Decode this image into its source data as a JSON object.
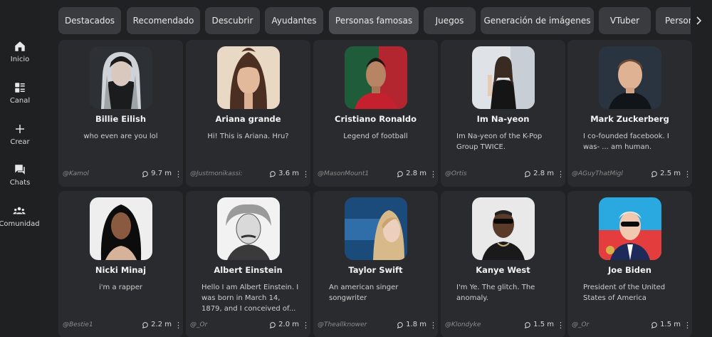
{
  "sidebar": {
    "items": [
      {
        "label": "Inicio",
        "icon": "home-icon"
      },
      {
        "label": "Canal",
        "icon": "feed-icon"
      },
      {
        "label": "Crear",
        "icon": "plus-icon"
      },
      {
        "label": "Chats",
        "icon": "chat-icon"
      },
      {
        "label": "Comunidad",
        "icon": "community-icon"
      }
    ]
  },
  "tabs": [
    {
      "label": "Destacados"
    },
    {
      "label": "Recomendado"
    },
    {
      "label": "Descubrir"
    },
    {
      "label": "Ayudantes"
    },
    {
      "label": "Personas famosas"
    },
    {
      "label": "Juegos"
    },
    {
      "label": "Generación de imágenes"
    },
    {
      "label": "VTuber"
    },
    {
      "label": "Person"
    }
  ],
  "tabs_more_icon": "chevron-right-icon",
  "characters": [
    {
      "name": "Billie Eilish",
      "description": "who even are you lol",
      "creator": "@Kamol",
      "chats": "9.7 m"
    },
    {
      "name": "Ariana grande",
      "description": "Hi! This is Ariana. Hru?",
      "creator": "@Justmonikassi:",
      "chats": "3.6 m"
    },
    {
      "name": "Cristiano Ronaldo",
      "description": "Legend of football",
      "creator": "@MasonMount1",
      "chats": "2.8 m"
    },
    {
      "name": "Im Na-yeon",
      "description": "Im Na-yeon of the K-Pop Group TWICE.",
      "creator": "@Ortis",
      "chats": "2.8 m"
    },
    {
      "name": "Mark Zuckerberg",
      "description": "I co-founded facebook. I was- ... am human.",
      "creator": "@AGuyThatMigl",
      "chats": "2.5 m"
    },
    {
      "name": "Nicki Minaj",
      "description": "i'm a rapper",
      "creator": "@Bestie1",
      "chats": "2.2 m"
    },
    {
      "name": "Albert Einstein",
      "description": "Hello I am Albert Einstein. I was born in March 14, 1879, and I conceived of...",
      "creator": "@_Or",
      "chats": "2.0 m"
    },
    {
      "name": "Taylor Swift",
      "description": "An american singer songwriter",
      "creator": "@Theallknower",
      "chats": "1.8 m"
    },
    {
      "name": "Kanye West",
      "description": "I'm Ye. The glitch. The anomaly.",
      "creator": "@Klondyke",
      "chats": "1.5 m"
    },
    {
      "name": "Joe Biden",
      "description": "President of the United States of America",
      "creator": "@_Or",
      "chats": "1.5 m"
    }
  ],
  "colors": {
    "background": "#202123",
    "card": "#2a2b2e",
    "tab": "#3a3b3e"
  }
}
